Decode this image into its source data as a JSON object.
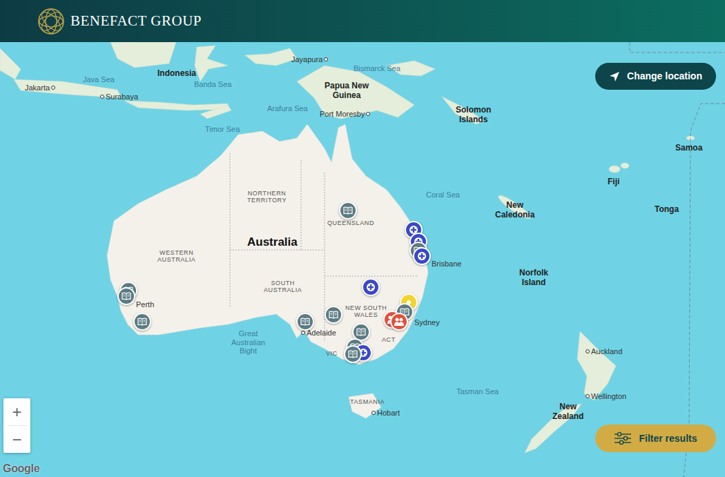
{
  "header": {
    "logo_text": "BENEFACT GROUP"
  },
  "map": {
    "labels": [
      {
        "lines": [
          "Jayapura"
        ],
        "kind": "city"
      },
      {
        "lines": [
          "Bismarck Sea"
        ],
        "kind": "sea"
      },
      {
        "lines": [
          "Indonesia"
        ],
        "kind": "country"
      },
      {
        "lines": [
          "Java Sea"
        ],
        "kind": "sea"
      },
      {
        "lines": [
          "Banda Sea"
        ],
        "kind": "sea"
      },
      {
        "lines": [
          "Jakarta"
        ],
        "kind": "city"
      },
      {
        "lines": [
          "Surabaya"
        ],
        "kind": "city"
      },
      {
        "lines": [
          "Papua New",
          "Guinea"
        ],
        "kind": "country"
      },
      {
        "lines": [
          "Port Moresby"
        ],
        "kind": "city"
      },
      {
        "lines": [
          "Arafura Sea"
        ],
        "kind": "sea"
      },
      {
        "lines": [
          "Timor Sea"
        ],
        "kind": "sea"
      },
      {
        "lines": [
          "Solomon",
          "Islands"
        ],
        "kind": "country"
      },
      {
        "lines": [
          "Samoa"
        ],
        "kind": "country"
      },
      {
        "lines": [
          "Fiji"
        ],
        "kind": "country"
      },
      {
        "lines": [
          "Coral Sea"
        ],
        "kind": "sea"
      },
      {
        "lines": [
          "New",
          "Caledonia"
        ],
        "kind": "country"
      },
      {
        "lines": [
          "Tonga"
        ],
        "kind": "country"
      },
      {
        "lines": [
          "NORTHERN",
          "TERRITORY"
        ],
        "kind": "state"
      },
      {
        "lines": [
          "QUEENSLAND"
        ],
        "kind": "state"
      },
      {
        "lines": [
          "Australia"
        ],
        "kind": "continent"
      },
      {
        "lines": [
          "WESTERN",
          "AUSTRALIA"
        ],
        "kind": "state"
      },
      {
        "lines": [
          "SOUTH",
          "AUSTRALIA"
        ],
        "kind": "state"
      },
      {
        "lines": [
          "Brisbane"
        ],
        "kind": "city"
      },
      {
        "lines": [
          "Perth"
        ],
        "kind": "city"
      },
      {
        "lines": [
          "NEW SOUTH",
          "WALES"
        ],
        "kind": "state"
      },
      {
        "lines": [
          "Sydney"
        ],
        "kind": "city"
      },
      {
        "lines": [
          "Adelaide"
        ],
        "kind": "city"
      },
      {
        "lines": [
          "ACT"
        ],
        "kind": "state"
      },
      {
        "lines": [
          "VIC"
        ],
        "kind": "state"
      },
      {
        "lines": [
          "Great",
          "Australian",
          "Bight"
        ],
        "kind": "sea"
      },
      {
        "lines": [
          "TASMANIA"
        ],
        "kind": "state"
      },
      {
        "lines": [
          "Hobart"
        ],
        "kind": "city"
      },
      {
        "lines": [
          "Tasman Sea"
        ],
        "kind": "sea"
      },
      {
        "lines": [
          "Norfolk",
          "Island"
        ],
        "kind": "country"
      },
      {
        "lines": [
          "Auckland"
        ],
        "kind": "city"
      },
      {
        "lines": [
          "Wellington"
        ],
        "kind": "city"
      },
      {
        "lines": [
          "New",
          "Zealand"
        ],
        "kind": "country"
      }
    ],
    "pins": [
      {
        "kind": "book",
        "color": "#5b7b82"
      },
      {
        "kind": "medical",
        "color": "#3b48c6"
      },
      {
        "kind": "medical",
        "color": "#3b48c6"
      },
      {
        "kind": "book",
        "color": "#5b7b82"
      },
      {
        "kind": "medical",
        "color": "#3b48c6"
      },
      {
        "kind": "book",
        "color": "#5b7b82"
      },
      {
        "kind": "book",
        "color": "#5b7b82"
      },
      {
        "kind": "book",
        "color": "#5b7b82"
      },
      {
        "kind": "book",
        "color": "#5b7b82"
      },
      {
        "kind": "book",
        "color": "#5b7b82"
      },
      {
        "kind": "medical",
        "color": "#3b48c6"
      },
      {
        "kind": "other",
        "color": "#f2d42e"
      },
      {
        "kind": "book",
        "color": "#5b7b82"
      },
      {
        "kind": "people",
        "color": "#e2503d"
      },
      {
        "kind": "people",
        "color": "#e2503d"
      },
      {
        "kind": "book",
        "color": "#5b7b82"
      },
      {
        "kind": "book",
        "color": "#5b7b82"
      },
      {
        "kind": "medical",
        "color": "#3b48c6"
      },
      {
        "kind": "book",
        "color": "#5b7b82"
      }
    ]
  },
  "controls": {
    "change_location": "Change location",
    "filter_results": "Filter results",
    "zoom_in": "+",
    "zoom_out": "−"
  },
  "attribution": "Google"
}
